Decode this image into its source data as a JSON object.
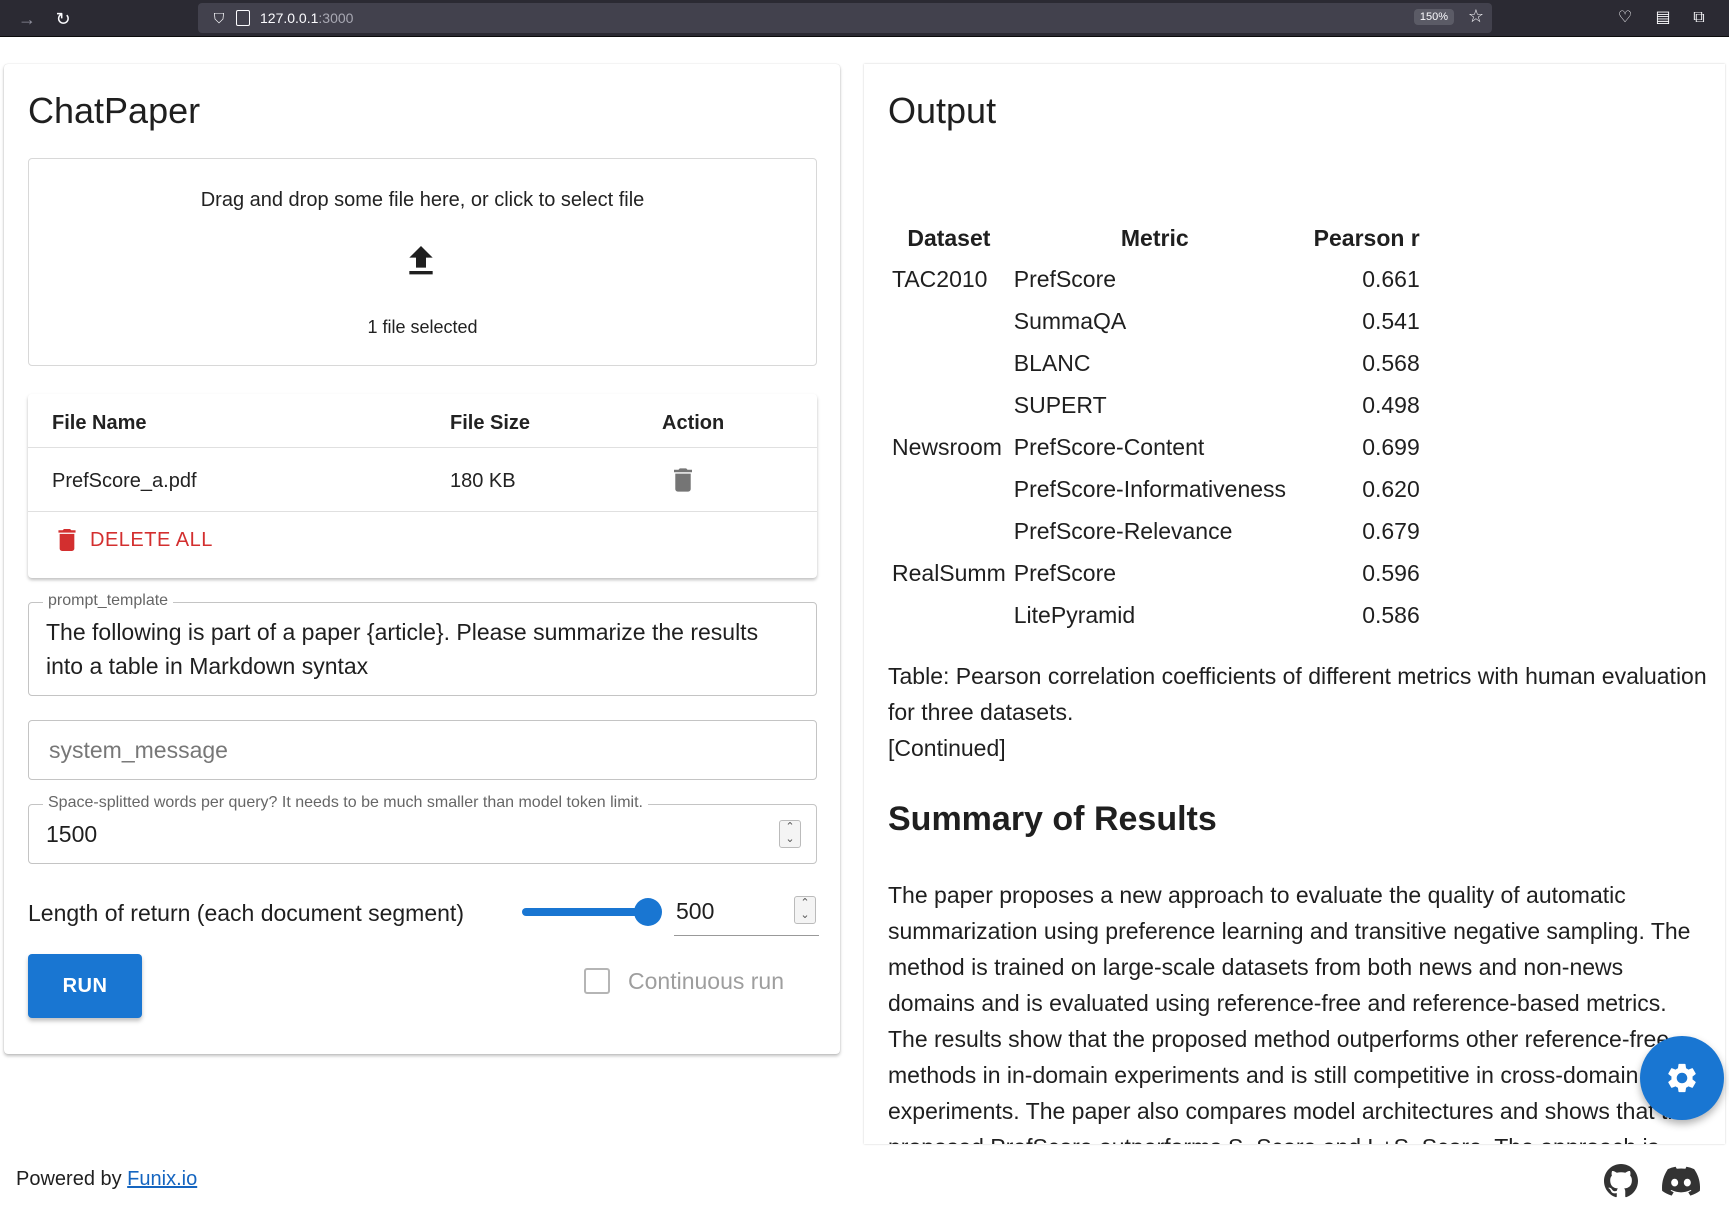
{
  "browser": {
    "url_host": "127.0.0.1",
    "url_port": ":3000",
    "zoom": "150%"
  },
  "left": {
    "title": "ChatPaper",
    "dropzone": {
      "prompt": "Drag and drop some file here, or click to select file",
      "selected": "1 file selected"
    },
    "file_table": {
      "headers": [
        "File Name",
        "File Size",
        "Action"
      ],
      "rows": [
        {
          "name": "PrefScore_a.pdf",
          "size": "180 KB"
        }
      ],
      "delete_all": "DELETE ALL"
    },
    "prompt_template": {
      "label": "prompt_template",
      "value": "The following is part of a paper {article}. Please summarize the results into a table in Markdown syntax"
    },
    "system_message": {
      "placeholder": "system_message"
    },
    "words_per_query": {
      "label": "Space-splitted words per query? It needs to be much smaller than model token limit.",
      "value": "1500"
    },
    "length_of_return": {
      "label": "Length of return (each document segment)",
      "value": "500",
      "slider_fraction": 0.92
    },
    "run_label": "RUN",
    "continuous_label": "Continuous run"
  },
  "right": {
    "title": "Output",
    "table": {
      "headers": [
        "Dataset",
        "Metric",
        "Pearson r"
      ],
      "rows": [
        [
          "TAC2010",
          "PrefScore",
          "0.661"
        ],
        [
          "",
          "SummaQA",
          "0.541"
        ],
        [
          "",
          "BLANC",
          "0.568"
        ],
        [
          "",
          "SUPERT",
          "0.498"
        ],
        [
          "Newsroom",
          "PrefScore-Content",
          "0.699"
        ],
        [
          "",
          "PrefScore-Informativeness",
          "0.620"
        ],
        [
          "",
          "PrefScore-Relevance",
          "0.679"
        ],
        [
          "RealSumm",
          "PrefScore",
          "0.596"
        ],
        [
          "",
          "LitePyramid",
          "0.586"
        ]
      ]
    },
    "caption": "Table: Pearson correlation coefficients of different metrics with human evaluation for three datasets.",
    "continued": "[Continued]",
    "summary_heading": "Summary of Results",
    "summary_text": "The paper proposes a new approach to evaluate the quality of automatic summarization using preference learning and transitive negative sampling. The method is trained on large-scale datasets from both news and non-news domains and is evaluated using reference-free and reference-based metrics. The results show that the proposed method outperforms other reference-free methods in in-domain experiments and is still competitive in cross-domain experiments. The paper also compares model architectures and shows that the proposed PrefScore outperforms S_Score and L+S_Score. The approach is promising for evaluating the quality of"
  },
  "footer": {
    "powered_by": "Powered by ",
    "link": "Funix.io"
  },
  "colors": {
    "primary": "#1976d2",
    "danger": "#d32f2f"
  }
}
